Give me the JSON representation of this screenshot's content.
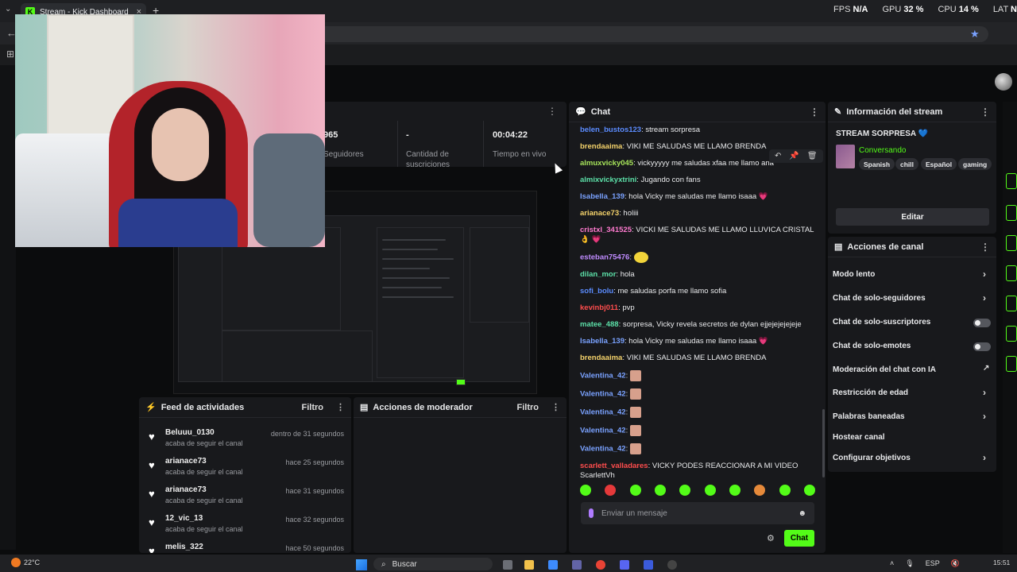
{
  "browser": {
    "tab_title": "Stream - Kick Dashboard",
    "tab_close": "×",
    "new_tab": "+",
    "perf": [
      {
        "label": "FPS",
        "value": "N/A"
      },
      {
        "label": "GPU",
        "value": "32 %"
      },
      {
        "label": "CPU",
        "value": "14 %"
      },
      {
        "label": "LAT",
        "value": "N"
      }
    ]
  },
  "stats": [
    {
      "value": "965",
      "label": "Seguidores"
    },
    {
      "value": "-",
      "label": "Cantidad de suscriciones"
    },
    {
      "value": "00:04:22",
      "label": "Tiempo en vivo"
    }
  ],
  "activity": {
    "title": "Feed de actividades",
    "filter": "Filtro",
    "items": [
      {
        "user": "Beluuu_0130",
        "desc": "acaba de seguir el canal",
        "time": "dentro de 31 segundos"
      },
      {
        "user": "arianace73",
        "desc": "acaba de seguir el canal",
        "time": "hace 25 segundos"
      },
      {
        "user": "arianace73",
        "desc": "acaba de seguir el canal",
        "time": "hace 31 segundos"
      },
      {
        "user": "12_vic_13",
        "desc": "acaba de seguir el canal",
        "time": "hace 32 segundos"
      },
      {
        "user": "melis_322",
        "desc": "",
        "time": "hace 50 segundos"
      }
    ]
  },
  "moderator": {
    "title": "Acciones de moderador",
    "filter": "Filtro"
  },
  "chat": {
    "title": "Chat",
    "messages": [
      {
        "user": "belen_bustos123",
        "color": "#5b8cff",
        "text": "stream sorpresa"
      },
      {
        "user": "brendaaima",
        "color": "#f5d36b",
        "text": "VIKI ME SALUDAS ME LLAMO BRENDA"
      },
      {
        "user": "almuxvicky045",
        "color": "#a6e35a",
        "text": "vickyyyyy me saludas xfaa me llamo ana"
      },
      {
        "user": "almixvickyxtrini",
        "color": "#5ce0a8",
        "text": "Jugando con fans"
      },
      {
        "user": "Isabella_139",
        "color": "#7aa2ff",
        "text": "hola Vicky me saludas me llamo isaaa 💗"
      },
      {
        "user": "arianace73",
        "color": "#f5d36b",
        "text": "holiii"
      },
      {
        "user": "cristxl_341525",
        "color": "#ff7bd0",
        "text": "VICKI ME SALUDAS ME LLAMO LLUVICA CRISTAL 👌 💗"
      },
      {
        "user": "esteban75476",
        "color": "#c08cff",
        "text": ""
      },
      {
        "user": "dilan_mor",
        "color": "#5ce0a8",
        "text": "hola"
      },
      {
        "user": "sofi_bolu",
        "color": "#5b8cff",
        "text": "me saludas porfa me llamo sofia"
      },
      {
        "user": "kevinbj011",
        "color": "#ff4d4d",
        "text": "pvp"
      },
      {
        "user": "matee_488",
        "color": "#5ce0a8",
        "text": "sorpresa, Vicky revela secretos de dylan ejjejejejejeje"
      },
      {
        "user": "Isabella_139",
        "color": "#7aa2ff",
        "text": "hola Vicky me saludas me llamo isaaa 💗"
      },
      {
        "user": "brendaaima",
        "color": "#f5d36b",
        "text": "VIKI ME SALUDAS ME LLAMO BRENDA"
      },
      {
        "user": "Valentina_42",
        "color": "#7aa2ff",
        "text": ""
      },
      {
        "user": "Valentina_42",
        "color": "#7aa2ff",
        "text": ""
      },
      {
        "user": "Valentina_42",
        "color": "#7aa2ff",
        "text": ""
      },
      {
        "user": "Valentina_42",
        "color": "#7aa2ff",
        "text": ""
      },
      {
        "user": "Valentina_42",
        "color": "#7aa2ff",
        "text": ""
      },
      {
        "user": "scarlett_valladares",
        "color": "#ff4d4d",
        "text": "VICKY PODES REACCIONAR A MI VIDEO ScarlettVh"
      }
    ],
    "input_placeholder": "Enviar un mensaje",
    "send_label": "Chat"
  },
  "stream_info": {
    "title": "Información del stream",
    "stream_title": "STREAM SORPRESA 💙",
    "category": "Conversando",
    "tags": [
      "Spanish",
      "chill",
      "Español",
      "gaming"
    ],
    "edit_label": "Editar"
  },
  "channel_actions": {
    "title": "Acciones de canal",
    "items": [
      {
        "label": "Modo lento",
        "control": "chevron"
      },
      {
        "label": "Chat de solo-seguidores",
        "control": "chevron"
      },
      {
        "label": "Chat de solo-suscriptores",
        "control": "toggle",
        "on": false
      },
      {
        "label": "Chat de solo-emotes",
        "control": "toggle",
        "on": false
      },
      {
        "label": "Moderación del chat con IA",
        "control": "external"
      },
      {
        "label": "Restricción de edad",
        "control": "chevron"
      },
      {
        "label": "Palabras baneadas",
        "control": "chevron"
      },
      {
        "label": "Hostear canal",
        "control": "none"
      },
      {
        "label": "Configurar objetivos",
        "control": "chevron"
      }
    ]
  },
  "taskbar": {
    "temperature": "22°C",
    "search_label": "Buscar",
    "lang": "ESP",
    "time": "15:51"
  },
  "colors": {
    "kick_green": "#53fc18",
    "panel": "#18191c",
    "bg": "#0b0c0d"
  }
}
